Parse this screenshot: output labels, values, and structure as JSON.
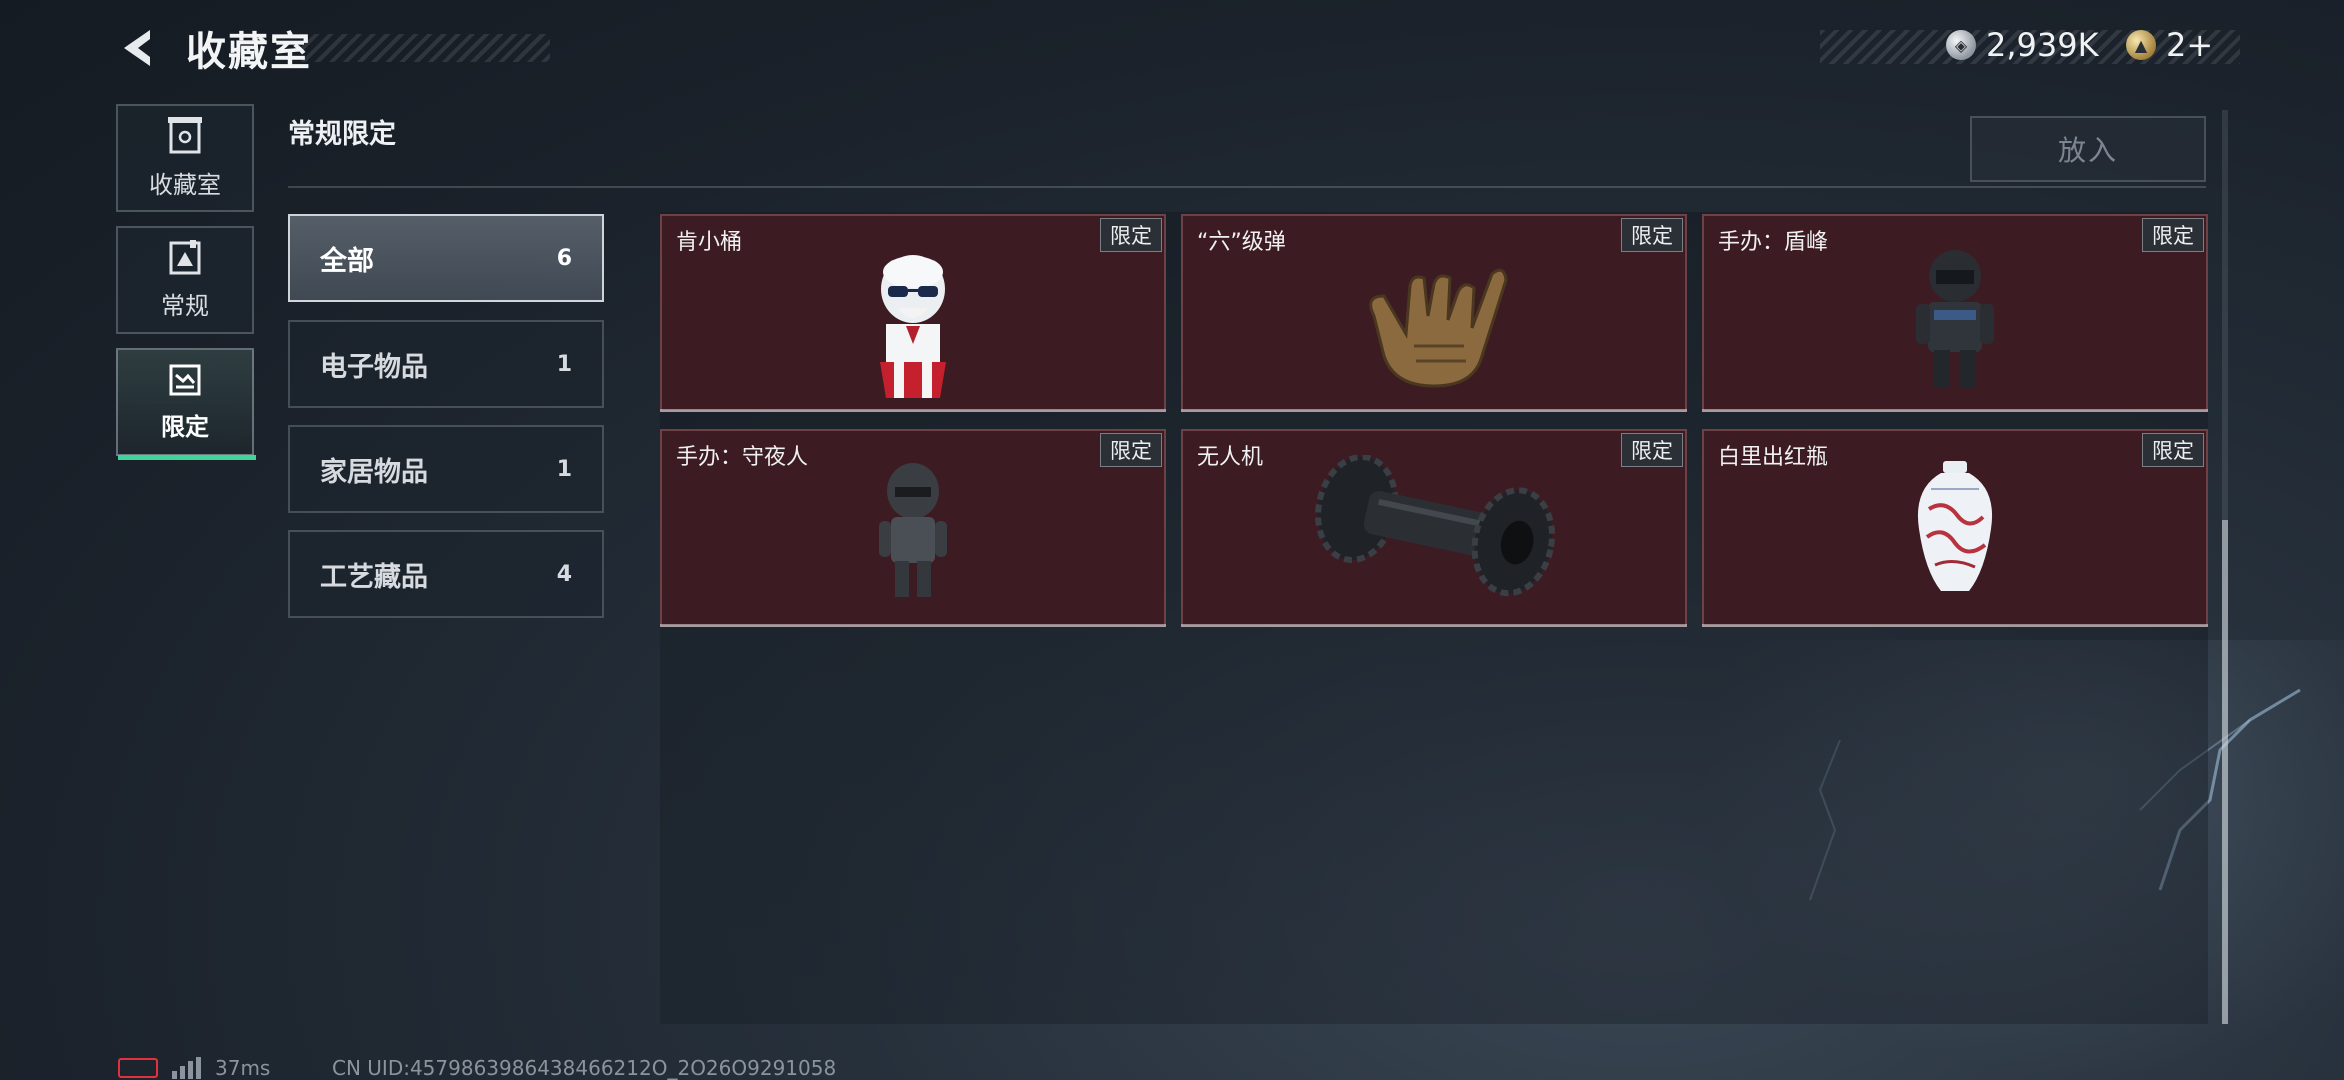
{
  "header": {
    "back_icon": "back-arrow-icon",
    "title": "收藏室",
    "currencies": [
      {
        "icon": "silver-coin-icon",
        "value": "2,939K"
      },
      {
        "icon": "gold-coin-icon",
        "value": "2+"
      }
    ]
  },
  "left_nav": {
    "items": [
      {
        "label": "收藏室",
        "icon": "collection-room-icon",
        "active": false
      },
      {
        "label": "常规",
        "icon": "regular-icon",
        "active": false
      },
      {
        "label": "限定",
        "icon": "limited-icon",
        "active": true
      }
    ],
    "active_underline_color": "#3fd59a"
  },
  "section": {
    "title": "常规限定",
    "put_in_button": "放入"
  },
  "categories": [
    {
      "label": "全部",
      "count": "6",
      "active": true
    },
    {
      "label": "电子物品",
      "count": "1",
      "active": false
    },
    {
      "label": "家居物品",
      "count": "1",
      "active": false
    },
    {
      "label": "工艺藏品",
      "count": "4",
      "active": false
    }
  ],
  "items": [
    {
      "name": "肯小桶",
      "tag": "限定",
      "icon": "kfc-colonel-figure-icon"
    },
    {
      "name": "“六”级弹",
      "tag": "限定",
      "icon": "shaka-hand-icon"
    },
    {
      "name": "手办：盾峰",
      "tag": "限定",
      "icon": "armored-soldier-figure-icon"
    },
    {
      "name": "手办：守夜人",
      "tag": "限定",
      "icon": "night-watcher-figure-icon"
    },
    {
      "name": "无人机",
      "tag": "限定",
      "icon": "tracked-drone-icon"
    },
    {
      "name": "白里出红瓶",
      "tag": "限定",
      "icon": "porcelain-vase-icon"
    }
  ],
  "colors": {
    "card_background": "#3c1c22",
    "accent_green": "#3fd59a",
    "battery_red": "#e0323d"
  },
  "footer": {
    "ping": "37ms",
    "uid": "CN UID:4579863986438466212O_2O26O9291058"
  }
}
